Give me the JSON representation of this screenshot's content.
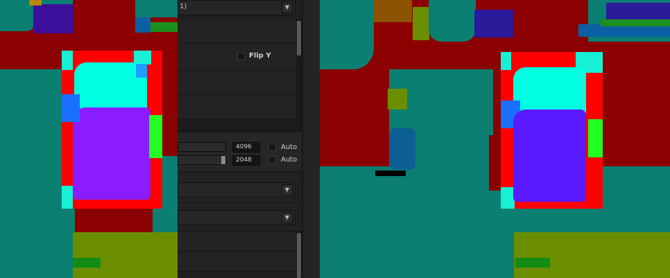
{
  "panel": {
    "top_dropdown_text": "1)",
    "flip_y_label": "Flip Y",
    "width_value": "4096",
    "height_value": "2048",
    "auto_label_1": "Auto",
    "auto_label_2": "Auto",
    "dropdown_arrow": "▼"
  },
  "colors": {
    "panel_bg": "#1f1f1f",
    "segmentation_red": "#ff0000",
    "segmentation_cyan": "#00ffe0",
    "segmentation_violet": "#8a1cff",
    "segmentation_teal": "#0b7f72",
    "segmentation_darkred": "#8b0000"
  }
}
